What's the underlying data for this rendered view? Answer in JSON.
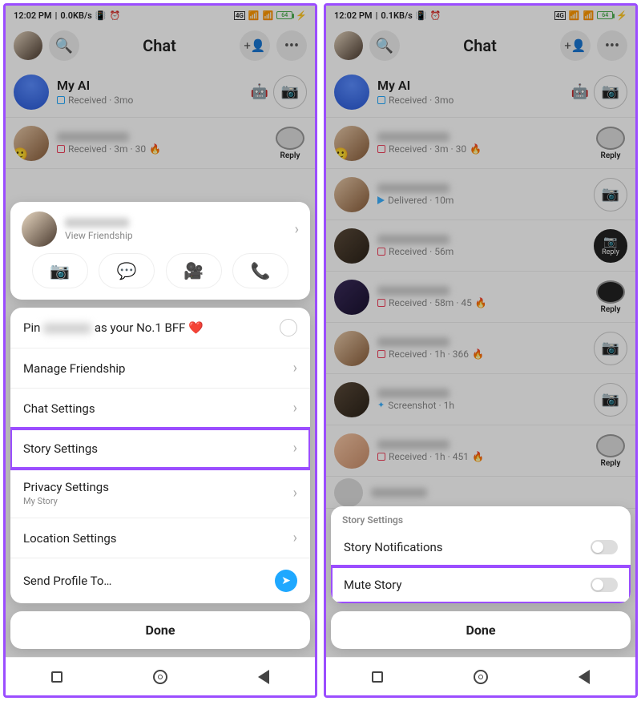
{
  "status": {
    "time": "12:02 PM",
    "net1": "0.0KB/s",
    "net2": "0.1KB/s",
    "carrier": "4G",
    "battery": "64"
  },
  "header": {
    "title": "Chat"
  },
  "chats": {
    "myai": {
      "name": "My AI",
      "sub": "Received · 3mo"
    },
    "row2_sub": "Received · 3m · 30",
    "row3_sub": "Delivered · 10m",
    "row4_sub": "Received · 56m",
    "row5_sub": "Received · 58m · 45",
    "row6_sub": "Received · 1h · 366",
    "row7_sub": "Screenshot · 1h",
    "row8_sub": "Received · 1h · 451",
    "reply_label": "Reply"
  },
  "sheet1": {
    "view_friendship": "View Friendship",
    "pin_prefix": "Pin",
    "pin_suffix": "as your No.1 BFF ❤️",
    "manage": "Manage Friendship",
    "chat_settings": "Chat Settings",
    "story_settings": "Story Settings",
    "privacy": "Privacy Settings",
    "privacy_sub": "My Story",
    "location": "Location Settings",
    "send_profile": "Send Profile To…",
    "done": "Done"
  },
  "sheet2": {
    "header": "Story Settings",
    "notifications": "Story Notifications",
    "mute": "Mute Story",
    "done": "Done"
  }
}
